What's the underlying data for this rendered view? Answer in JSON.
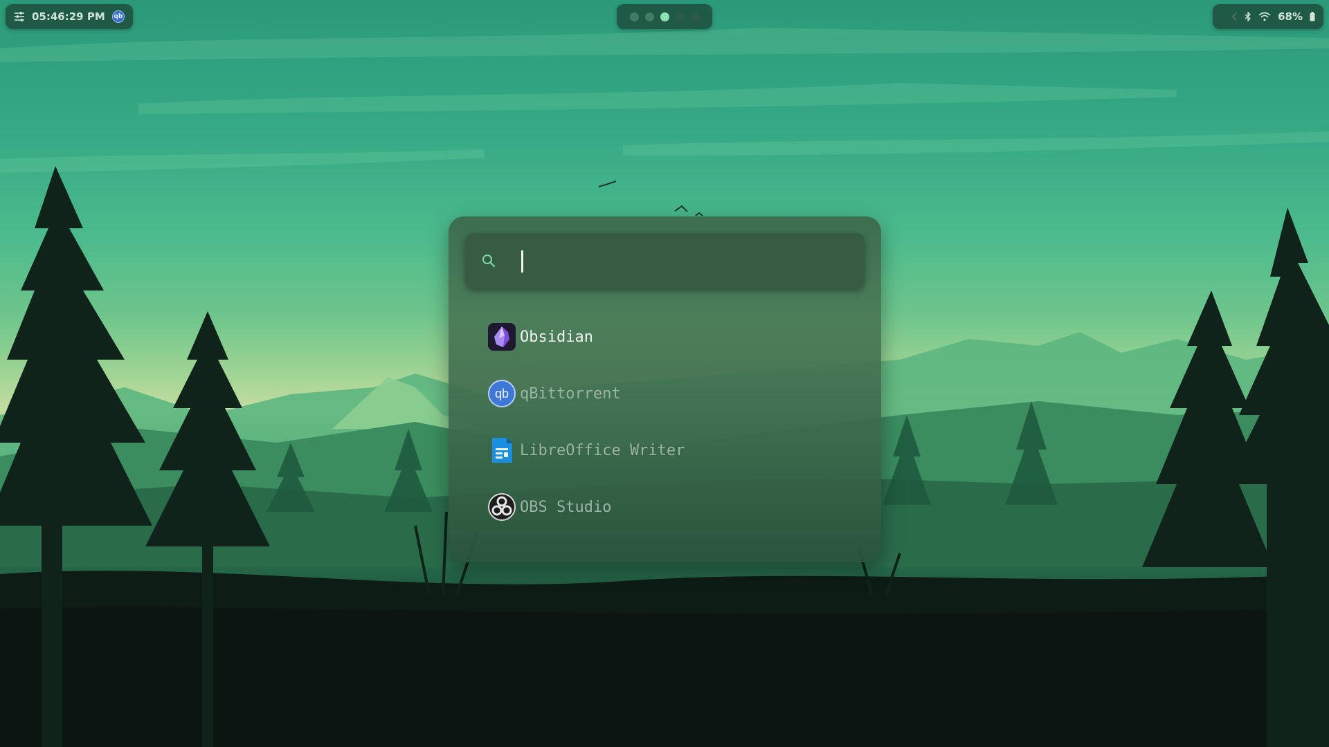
{
  "topbar": {
    "clock": "05:46:29 PM",
    "tray_icon": "qbittorrent-tray-icon",
    "tray_icon_text": "qb",
    "workspaces": [
      {
        "id": 1,
        "state": "occupied"
      },
      {
        "id": 2,
        "state": "occupied"
      },
      {
        "id": 3,
        "state": "active"
      },
      {
        "id": 4,
        "state": "empty"
      },
      {
        "id": 5,
        "state": "empty"
      }
    ],
    "battery": "68%"
  },
  "launcher": {
    "search": {
      "value": "",
      "placeholder": ""
    },
    "results": [
      {
        "label": "Obsidian",
        "icon": "obsidian-icon",
        "selected": true
      },
      {
        "label": "qBittorrent",
        "icon": "qbittorrent-icon",
        "selected": false
      },
      {
        "label": "LibreOffice Writer",
        "icon": "libreoffice-writer-icon",
        "selected": false
      },
      {
        "label": "OBS Studio",
        "icon": "obs-studio-icon",
        "selected": false
      }
    ]
  },
  "colors": {
    "accent": "#8fe0b4",
    "selected_text": "#eef4ee",
    "unselected_text": "#9ab4a2",
    "panel_bg": "#3a6a4c"
  }
}
